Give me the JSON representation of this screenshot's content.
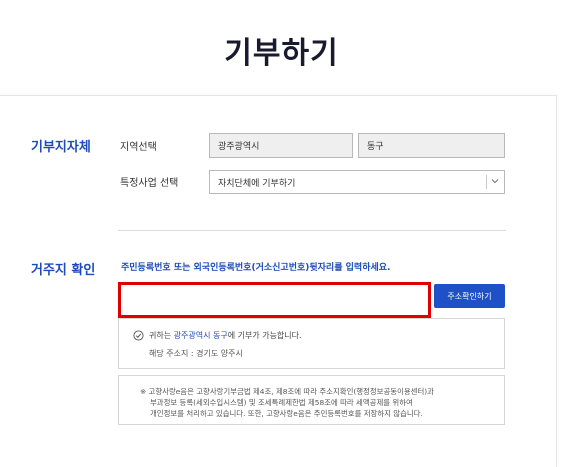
{
  "page": {
    "title": "기부하기"
  },
  "donation_target": {
    "section_title": "기부지자체",
    "region_label": "지역선택",
    "province_value": "광주광역시",
    "district_value": "동구",
    "project_label": "특정사업 선택",
    "project_value": "자치단체에 기부하기"
  },
  "residence": {
    "section_title": "거주지 확인",
    "instruction": "주민등록번호 또는 외국인등록번호(거소신고번호)뒷자리를 입력하세요.",
    "id_input_value": "",
    "confirm_button": "주소확인하기",
    "result": {
      "prefix": "귀하는 ",
      "highlight": "광주광역시 동구",
      "suffix": "에 기부가 가능합니다.",
      "address_line": "해당 주소지 : 경기도 양주시"
    },
    "notice": {
      "line1": "※ 고향사랑e음은 고향사랑기부금법 제4조, 제8조에 따라 주소지확인(행정정보공동이용센터)과",
      "line2": "부과정보 등록(세외수입시스템) 및 조세특례제한법 제58조에 따라 세액공제를 위하여",
      "line3": "개인정보를 처리하고 있습니다. 또한, 고향사랑e음은 주민등록번호를 저장하지 않습니다."
    }
  },
  "colors": {
    "accent": "#1d4bb8",
    "button": "#1e50c8",
    "highlight_border": "#e10000"
  },
  "icons": {
    "check": "check-circle-icon",
    "dropdown": "chevron-down-icon"
  }
}
